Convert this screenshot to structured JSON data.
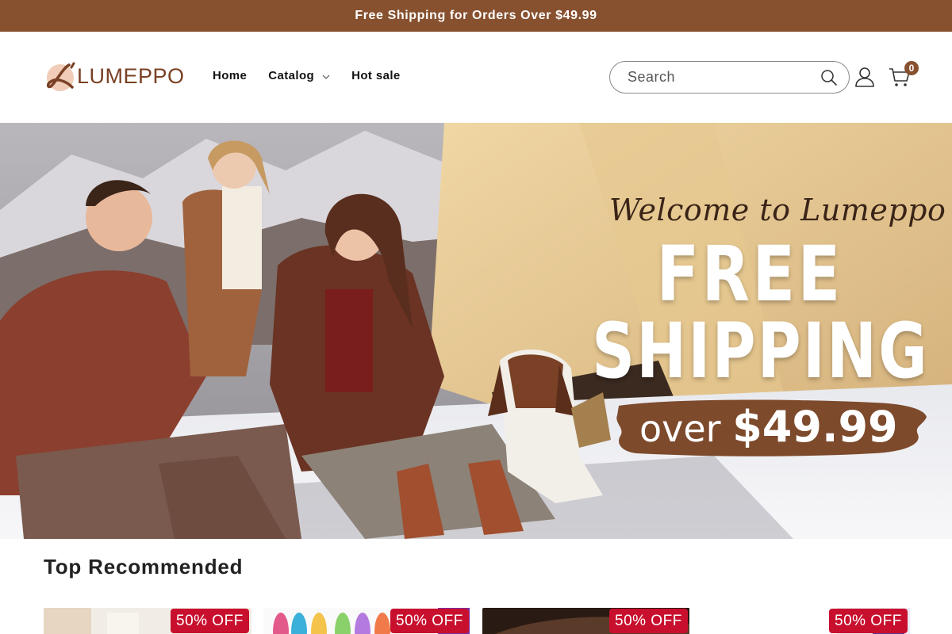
{
  "announcement": {
    "text": "Free Shipping for Orders Over $49.99"
  },
  "header": {
    "logo_text": "LUMEPPO",
    "nav": [
      {
        "label": "Home"
      },
      {
        "label": "Catalog",
        "has_dropdown": true
      },
      {
        "label": "Hot sale"
      }
    ],
    "search": {
      "placeholder": "Search",
      "value": ""
    },
    "cart_count": "0"
  },
  "hero": {
    "welcome": "Welcome to Lumeppo",
    "line1": "FREE",
    "line2": "SHIPPING",
    "over_prefix": "over",
    "over_amount": "$49.99"
  },
  "recommended": {
    "title": "Top Recommended",
    "products": [
      {
        "badge": "50% OFF"
      },
      {
        "badge": "50% OFF"
      },
      {
        "badge": "50% OFF"
      },
      {
        "badge": "50% OFF"
      }
    ]
  },
  "colors": {
    "accent": "#87512f",
    "badge": "#c8102e"
  }
}
